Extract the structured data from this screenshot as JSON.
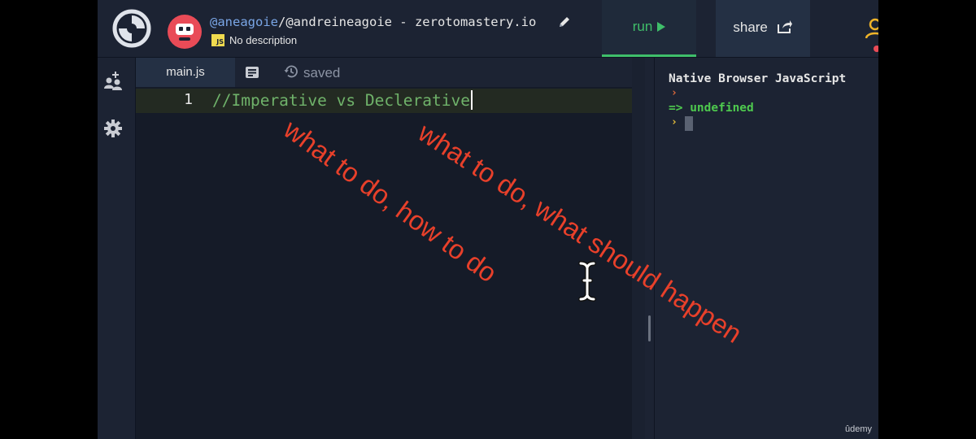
{
  "header": {
    "user": "@aneagoie",
    "repl_path": "/@andreineagoie - zerotomastery.io",
    "language_badge": "JS",
    "description": "No description",
    "run_label": "run",
    "share_label": "share"
  },
  "editor": {
    "tab_label": "main.js",
    "saved_label": "saved",
    "line_number": "1",
    "code": "//Imperative vs Declerative"
  },
  "console": {
    "title": "Native Browser JavaScript",
    "prompt_symbol": "›",
    "result": "=> undefined"
  },
  "annotations": [
    "what to do, how to do",
    "what to do, what should happen"
  ],
  "watermark": "ûdemy",
  "colors": {
    "accent_run": "#3fbf6a",
    "annotation": "#e8402a",
    "code_comment": "#6fb26a",
    "avatar": "#e94b57"
  },
  "icons": [
    "repl-logo-icon",
    "avatar",
    "pencil-icon",
    "play-icon",
    "share-icon",
    "user-icon",
    "multiplayer-icon",
    "settings-icon",
    "files-icon",
    "history-icon",
    "text-cursor-icon"
  ]
}
